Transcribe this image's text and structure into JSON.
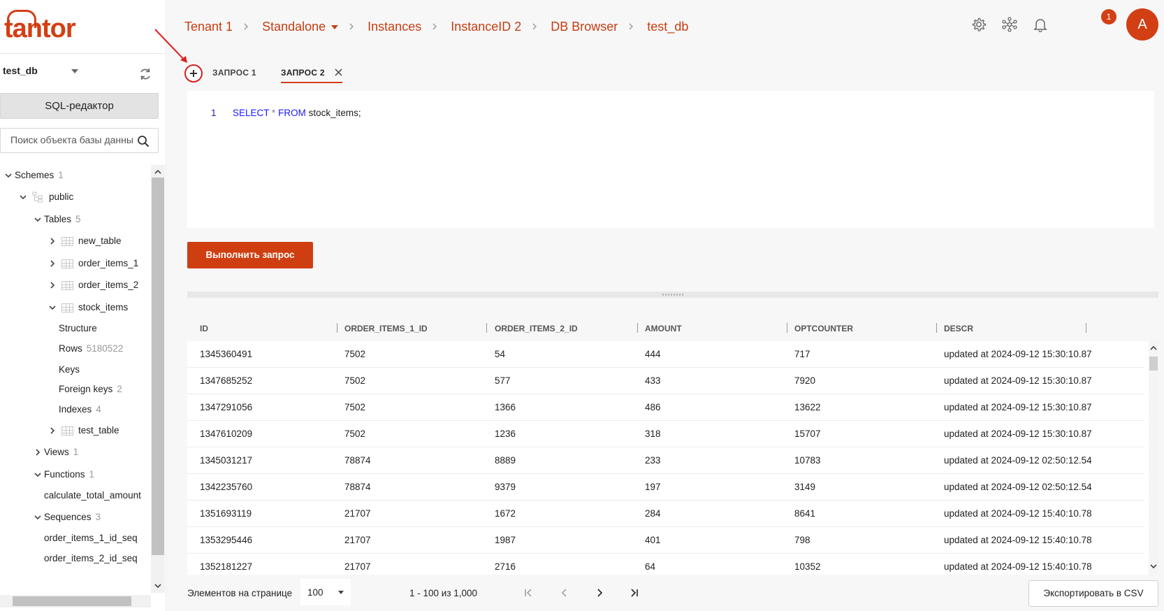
{
  "brand": {
    "logo_text": "tantor",
    "accent": "#d23f14"
  },
  "sidebar": {
    "db_selected": "test_db",
    "sql_editor_label": "SQL-редактор",
    "search_placeholder": "Поиск объекта базы данных",
    "tree": [
      {
        "label": "Schemes",
        "count": "1",
        "level": 0,
        "expanded": true,
        "icon": "chevron-down"
      },
      {
        "label": "public",
        "count": "",
        "level": 1,
        "expanded": true,
        "icon": "schema"
      },
      {
        "label": "Tables",
        "count": "5",
        "level": 2,
        "expanded": true
      },
      {
        "label": "new_table",
        "count": "",
        "level": 3,
        "expanded": false,
        "icon": "table"
      },
      {
        "label": "order_items_1",
        "count": "",
        "level": 3,
        "expanded": false,
        "icon": "table"
      },
      {
        "label": "order_items_2",
        "count": "",
        "level": 3,
        "expanded": false,
        "icon": "table"
      },
      {
        "label": "stock_items",
        "count": "",
        "level": 3,
        "expanded": true,
        "icon": "table"
      },
      {
        "label": "Structure",
        "count": "",
        "level": 4
      },
      {
        "label": "Rows",
        "count": "5180522",
        "level": 4
      },
      {
        "label": "Keys",
        "count": "",
        "level": 4
      },
      {
        "label": "Foreign keys",
        "count": "2",
        "level": 4
      },
      {
        "label": "Indexes",
        "count": "4",
        "level": 4
      },
      {
        "label": "test_table",
        "count": "",
        "level": 3,
        "expanded": false,
        "icon": "table"
      },
      {
        "label": "Views",
        "count": "1",
        "level": 2,
        "expanded": false
      },
      {
        "label": "Functions",
        "count": "1",
        "level": 2,
        "expanded": true
      },
      {
        "label": "calculate_total_amount",
        "count": "",
        "level": 3
      },
      {
        "label": "Sequences",
        "count": "3",
        "level": 2,
        "expanded": true
      },
      {
        "label": "order_items_1_id_seq",
        "count": "",
        "level": 3
      },
      {
        "label": "order_items_2_id_seq",
        "count": "",
        "level": 3
      }
    ]
  },
  "breadcrumb": [
    "Tenant 1",
    "Standalone",
    "Instances",
    "InstanceID 2",
    "DB Browser",
    "test_db"
  ],
  "header": {
    "notifications_count": "1",
    "avatar_letter": "A"
  },
  "tabs": [
    {
      "label": "ЗАПРОС 1",
      "active": false
    },
    {
      "label": "ЗАПРОС 2",
      "active": true
    }
  ],
  "editor": {
    "line_number": "1",
    "kw1": "SELECT",
    "op": "*",
    "kw2": "FROM",
    "rest": "stock_items;"
  },
  "run_button": "Выполнить запрос",
  "grid": {
    "columns": [
      "ID",
      "ORDER_ITEMS_1_ID",
      "ORDER_ITEMS_2_ID",
      "AMOUNT",
      "OPTCOUNTER",
      "DESCR"
    ],
    "rows": [
      [
        "1345360491",
        "7502",
        "54",
        "444",
        "717",
        "updated at 2024-09-12 15:30:10.87"
      ],
      [
        "1347685252",
        "7502",
        "577",
        "433",
        "7920",
        "updated at 2024-09-12 15:30:10.87"
      ],
      [
        "1347291056",
        "7502",
        "1366",
        "486",
        "13622",
        "updated at 2024-09-12 15:30:10.87"
      ],
      [
        "1347610209",
        "7502",
        "1236",
        "318",
        "15707",
        "updated at 2024-09-12 15:30:10.87"
      ],
      [
        "1345031217",
        "78874",
        "8889",
        "233",
        "10783",
        "updated at 2024-09-12 02:50:12.54"
      ],
      [
        "1342235760",
        "78874",
        "9379",
        "197",
        "3149",
        "updated at 2024-09-12 02:50:12.54"
      ],
      [
        "1351693119",
        "21707",
        "1672",
        "284",
        "8641",
        "updated at 2024-09-12 15:40:10.78"
      ],
      [
        "1353295446",
        "21707",
        "1987",
        "401",
        "798",
        "updated at 2024-09-12 15:40:10.78"
      ],
      [
        "1352181227",
        "21707",
        "2716",
        "64",
        "10352",
        "updated at 2024-09-12 15:40:10.78"
      ]
    ]
  },
  "footer": {
    "page_size_label": "Элементов на странице",
    "page_size": "100",
    "range": "1 - 100 из 1,000",
    "export_label": "Экспортировать в CSV"
  }
}
